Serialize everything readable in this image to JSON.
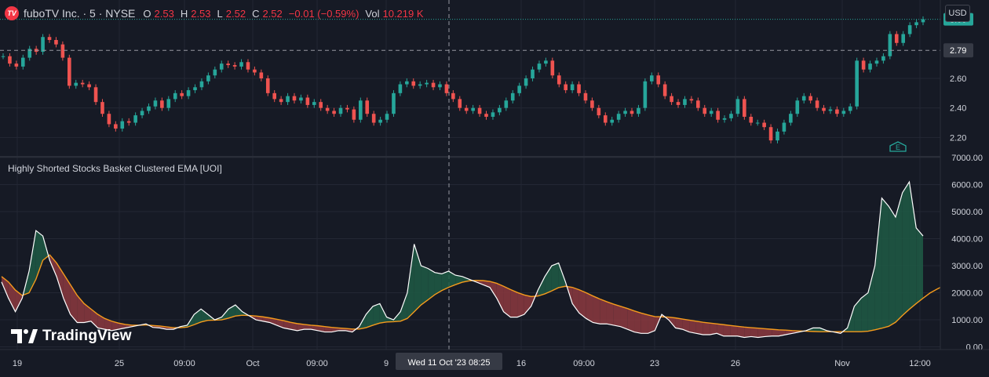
{
  "header": {
    "symbol": "fuboTV Inc. · 5 · NYSE",
    "logo_text": "TV",
    "open_label": "O",
    "open_value": "2.53",
    "high_label": "H",
    "high_value": "2.53",
    "low_label": "L",
    "low_value": "2.52",
    "close_label": "C",
    "close_value": "2.52",
    "change": "−0.01 (−0.59%)",
    "volume_label": "Vol",
    "volume_value": "10.219 K"
  },
  "currency": "USD",
  "indicator_title": "Highly Shorted Stocks Basket Clustered EMA [UOI]",
  "crosshair_time": "Wed 11 Oct '23   08:25",
  "branding": "TradingView",
  "colors": {
    "background": "#161a25",
    "up": "#26a69a",
    "down": "#ef5350",
    "ema": "#f59b1c",
    "price_line": "#26a69a",
    "white_line": "#ffffff",
    "fill_up": "#1e5c45",
    "fill_down": "#8c3a40"
  },
  "chart_data": [
    {
      "type": "line",
      "title": "fuboTV Inc. · 5 · NYSE",
      "xlabel": "",
      "ylabel": "",
      "x_ticks": [
        "19",
        "25",
        "09:00",
        "Oct",
        "09:00",
        "9",
        "16",
        "09:00",
        "23",
        "26",
        "Nov",
        "12:00"
      ],
      "y_ticks": [
        2.2,
        2.4,
        2.6,
        2.79,
        3.0
      ],
      "ylim": [
        2.08,
        3.12
      ],
      "current_price_label": "3.00",
      "crosshair_price_label": "2.79",
      "series": [
        {
          "kind": "candlestick-close",
          "values": [
            2.75,
            2.7,
            2.68,
            2.74,
            2.8,
            2.78,
            2.88,
            2.86,
            2.83,
            2.74,
            2.55,
            2.57,
            2.56,
            2.54,
            2.44,
            2.36,
            2.29,
            2.26,
            2.31,
            2.3,
            2.35,
            2.38,
            2.41,
            2.45,
            2.4,
            2.46,
            2.5,
            2.48,
            2.52,
            2.54,
            2.58,
            2.62,
            2.66,
            2.7,
            2.69,
            2.68,
            2.71,
            2.66,
            2.64,
            2.6,
            2.5,
            2.46,
            2.44,
            2.48,
            2.45,
            2.47,
            2.42,
            2.44,
            2.4,
            2.38,
            2.36,
            2.4,
            2.39,
            2.32,
            2.45,
            2.36,
            2.3,
            2.32,
            2.36,
            2.5,
            2.56,
            2.58,
            2.55,
            2.56,
            2.57,
            2.54,
            2.56,
            2.5,
            2.46,
            2.4,
            2.38,
            2.4,
            2.36,
            2.34,
            2.37,
            2.4,
            2.45,
            2.5,
            2.55,
            2.6,
            2.66,
            2.7,
            2.72,
            2.62,
            2.56,
            2.52,
            2.56,
            2.5,
            2.45,
            2.4,
            2.35,
            2.3,
            2.32,
            2.36,
            2.38,
            2.36,
            2.4,
            2.58,
            2.62,
            2.56,
            2.48,
            2.44,
            2.42,
            2.46,
            2.45,
            2.4,
            2.36,
            2.38,
            2.32,
            2.33,
            2.36,
            2.46,
            2.34,
            2.3,
            2.3,
            2.27,
            2.18,
            2.24,
            2.3,
            2.36,
            2.45,
            2.48,
            2.45,
            2.4,
            2.38,
            2.39,
            2.36,
            2.38,
            2.41,
            2.72,
            2.66,
            2.7,
            2.72,
            2.75,
            2.9,
            2.84,
            2.9,
            2.96,
            2.98,
            3.0
          ]
        }
      ]
    },
    {
      "type": "area",
      "title": "Highly Shorted Stocks Basket Clustered EMA [UOI]",
      "xlabel": "",
      "ylabel": "",
      "y_ticks": [
        0.0,
        1000.0,
        2000.0,
        3000.0,
        4000.0,
        5000.0,
        6000.0,
        7000.0
      ],
      "y_tick_labels": [
        "0.00",
        "1000.00",
        "2000.00",
        "3000.00",
        "4000.00",
        "5000.00",
        "6000.00",
        "7000.00"
      ],
      "ylim": [
        -100,
        7000
      ],
      "series": [
        {
          "name": "",
          "kind": "value",
          "values": [
            2400,
            1800,
            1300,
            1800,
            2800,
            4300,
            4100,
            3200,
            2600,
            1800,
            1200,
            900,
            900,
            950,
            700,
            650,
            600,
            650,
            700,
            750,
            800,
            850,
            720,
            700,
            650,
            650,
            750,
            800,
            1200,
            1400,
            1200,
            1000,
            1100,
            1400,
            1550,
            1300,
            1150,
            1000,
            950,
            900,
            800,
            700,
            650,
            600,
            650,
            650,
            600,
            550,
            550,
            600,
            600,
            550,
            750,
            1200,
            1500,
            1600,
            1100,
            1000,
            1300,
            2000,
            3800,
            3000,
            2900,
            2750,
            2700,
            2800,
            2650,
            2600,
            2500,
            2400,
            2300,
            2200,
            1800,
            1300,
            1100,
            1100,
            1200,
            1500,
            2100,
            2600,
            3000,
            3100,
            2400,
            1600,
            1250,
            1050,
            900,
            850,
            850,
            800,
            750,
            650,
            550,
            500,
            500,
            600,
            1200,
            1000,
            700,
            650,
            550,
            500,
            450,
            450,
            500,
            400,
            400,
            400,
            350,
            380,
            350,
            380,
            400,
            400,
            450,
            500,
            550,
            600,
            700,
            700,
            600,
            550,
            500,
            700,
            1500,
            1800,
            2000,
            3000,
            5500,
            5200,
            4800,
            5700,
            6100,
            4400,
            4100
          ]
        },
        {
          "name": "",
          "kind": "ema",
          "values": [
            2600,
            2400,
            2100,
            1900,
            2000,
            2500,
            3200,
            3400,
            3100,
            2700,
            2300,
            1900,
            1600,
            1400,
            1200,
            1050,
            950,
            880,
            830,
            800,
            800,
            810,
            790,
            770,
            740,
            710,
            710,
            730,
            820,
            920,
            980,
            990,
            1000,
            1060,
            1140,
            1170,
            1160,
            1140,
            1110,
            1070,
            1020,
            970,
            910,
            860,
            830,
            800,
            780,
            750,
            720,
            700,
            680,
            660,
            660,
            710,
            800,
            880,
            920,
            930,
            950,
            1050,
            1300,
            1550,
            1740,
            1930,
            2080,
            2200,
            2300,
            2390,
            2440,
            2460,
            2450,
            2420,
            2350,
            2240,
            2120,
            2010,
            1920,
            1860,
            1880,
            1960,
            2070,
            2190,
            2240,
            2200,
            2110,
            2000,
            1880,
            1770,
            1670,
            1580,
            1500,
            1420,
            1330,
            1250,
            1180,
            1120,
            1110,
            1100,
            1070,
            1030,
            990,
            950,
            910,
            880,
            850,
            820,
            790,
            760,
            730,
            710,
            690,
            670,
            650,
            630,
            620,
            600,
            590,
            580,
            570,
            560,
            560,
            560,
            560,
            560,
            560,
            560,
            580,
            630,
            690,
            760,
            910,
            1160,
            1390,
            1600,
            1800,
            1990,
            2130,
            2260
          ]
        }
      ]
    }
  ]
}
